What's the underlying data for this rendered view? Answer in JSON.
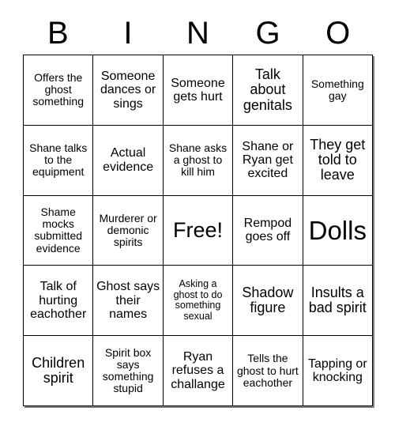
{
  "header": {
    "letters": [
      "B",
      "I",
      "N",
      "G",
      "O"
    ]
  },
  "grid": {
    "rows": [
      [
        {
          "text": "Offers the ghost something",
          "size": "sm"
        },
        {
          "text": "Someone dances or sings",
          "size": "md"
        },
        {
          "text": "Someone gets hurt",
          "size": "md"
        },
        {
          "text": "Talk about genitals",
          "size": "lg"
        },
        {
          "text": "Something gay",
          "size": "sm"
        }
      ],
      [
        {
          "text": "Shane talks to the equipment",
          "size": "sm"
        },
        {
          "text": "Actual evidence",
          "size": "md"
        },
        {
          "text": "Shane asks a ghost to kill him",
          "size": "sm"
        },
        {
          "text": "Shane or Ryan get excited",
          "size": "md"
        },
        {
          "text": "They get told to leave",
          "size": "lg"
        }
      ],
      [
        {
          "text": "Shame mocks submitted evidence",
          "size": "sm"
        },
        {
          "text": "Murderer or demonic spirits",
          "size": "sm"
        },
        {
          "text": "Free!",
          "size": "xxl"
        },
        {
          "text": "Rempod goes off",
          "size": "md"
        },
        {
          "text": "Dolls",
          "size": "huge"
        }
      ],
      [
        {
          "text": "Talk of hurting eachother",
          "size": "md"
        },
        {
          "text": "Ghost says their names",
          "size": "md"
        },
        {
          "text": "Asking a ghost to do something sexual",
          "size": "xs"
        },
        {
          "text": "Shadow figure",
          "size": "lg"
        },
        {
          "text": "Insults a bad spirit",
          "size": "lg"
        }
      ],
      [
        {
          "text": "Children spirit",
          "size": "lg"
        },
        {
          "text": "Spirit box says something stupid",
          "size": "sm"
        },
        {
          "text": "Ryan refuses a challange",
          "size": "md"
        },
        {
          "text": "Tells the ghost to hurt eachother",
          "size": "sm"
        },
        {
          "text": "Tapping or knocking",
          "size": "md"
        }
      ]
    ]
  },
  "colors": {
    "text": "#000000",
    "border": "#000000",
    "background": "#ffffff",
    "shadow": "#808080"
  }
}
